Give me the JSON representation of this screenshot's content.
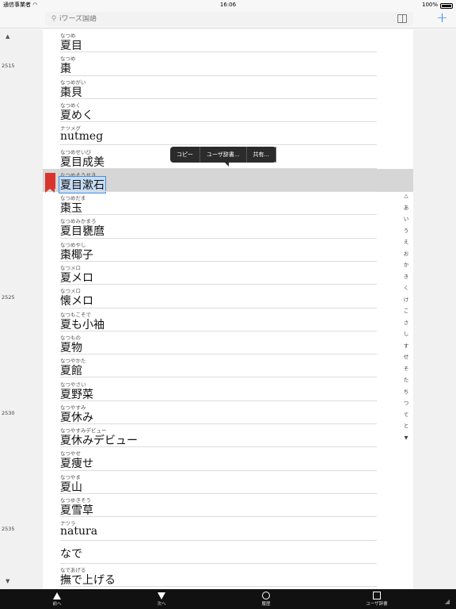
{
  "status": {
    "carrier": "通信事業者",
    "time": "16:06",
    "battery": "100%"
  },
  "search": {
    "placeholder": "iワーズ国語"
  },
  "popup": {
    "copy": "コピー",
    "user_dict": "ユーザ辞書...",
    "share": "共有..."
  },
  "line_numbers": [
    "2515",
    "2525",
    "2530",
    "2535"
  ],
  "entries": [
    {
      "reading": "なつめ",
      "word": "夏目"
    },
    {
      "reading": "なつめ",
      "word": "棗"
    },
    {
      "reading": "なつめがい",
      "word": "棗貝"
    },
    {
      "reading": "なつめく",
      "word": "夏めく"
    },
    {
      "reading": "ナツメグ",
      "word": "nutmeg"
    },
    {
      "reading": "なつめせいび",
      "word": "夏目成美"
    },
    {
      "reading": "なつめそうせき",
      "word": "夏目漱石"
    },
    {
      "reading": "なつめだま",
      "word": "棗玉"
    },
    {
      "reading": "なつめみかまろ",
      "word": "夏目甕麿"
    },
    {
      "reading": "なつめやし",
      "word": "棗椰子"
    },
    {
      "reading": "なつメロ",
      "word": "夏メロ"
    },
    {
      "reading": "なつメロ",
      "word": "懐メロ"
    },
    {
      "reading": "なつもこそで",
      "word": "夏も小袖"
    },
    {
      "reading": "なつもの",
      "word": "夏物"
    },
    {
      "reading": "なつやかた",
      "word": "夏館"
    },
    {
      "reading": "なつやさい",
      "word": "夏野菜"
    },
    {
      "reading": "なつやすみ",
      "word": "夏休み"
    },
    {
      "reading": "なつやすみデビュー",
      "word": "夏休みデビュー"
    },
    {
      "reading": "なつやせ",
      "word": "夏痩せ"
    },
    {
      "reading": "なつやま",
      "word": "夏山"
    },
    {
      "reading": "なつゆきそう",
      "word": "夏雪草"
    },
    {
      "reading": "ナツラ",
      "word": "natura"
    },
    {
      "reading": "",
      "word": "なで"
    },
    {
      "reading": "なであげる",
      "word": "撫で上げる"
    }
  ],
  "kana_index": [
    "あ",
    "い",
    "う",
    "え",
    "お",
    "か",
    "き",
    "く",
    "け",
    "こ",
    "さ",
    "し",
    "す",
    "せ",
    "そ",
    "た",
    "ち",
    "つ",
    "て",
    "と"
  ],
  "toolbar": {
    "prev": "前へ",
    "next": "次へ",
    "history": "履歴",
    "user_dict": "ユーザ辞書"
  }
}
